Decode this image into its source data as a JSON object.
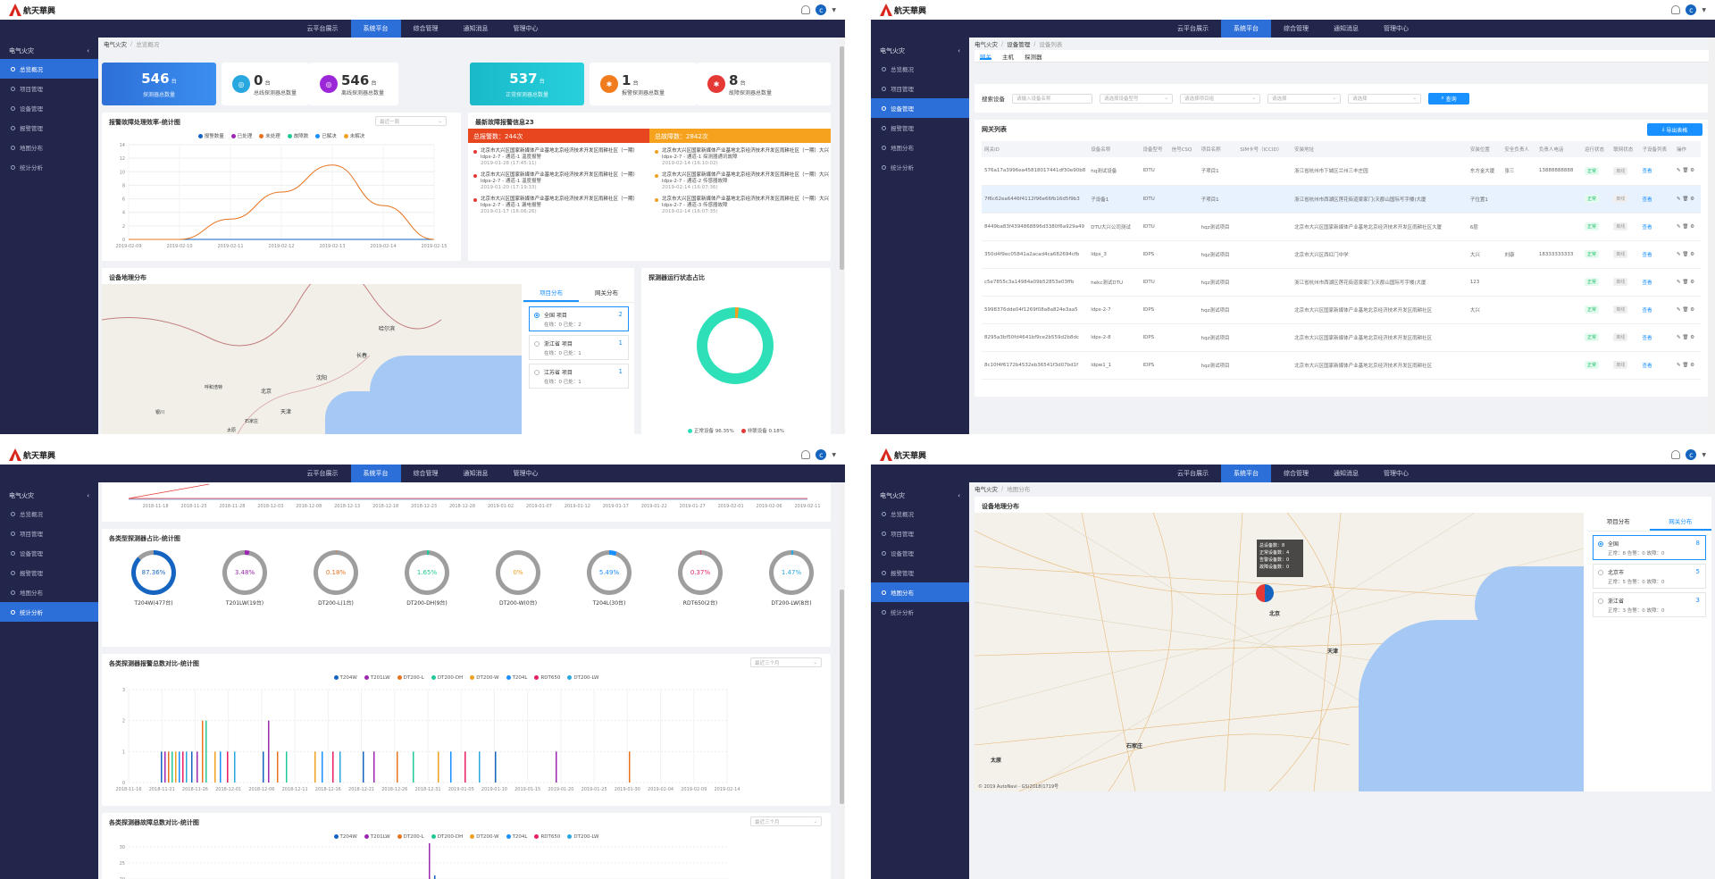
{
  "app": {
    "logo_text": "航天華興",
    "avatar_letter": "c",
    "nav": [
      "云平台展示",
      "系统平台",
      "综合管理",
      "通知消息",
      "管理中心"
    ],
    "active_nav": "系统平台",
    "sidebar_title": "电气火灾",
    "sidebar": [
      "总览概况",
      "项目管理",
      "设备管理",
      "报警管理",
      "地图分布",
      "统计分析"
    ]
  },
  "q1": {
    "breadcrumb": [
      "电气火灾",
      "总览概况"
    ],
    "stats": [
      {
        "num": "546",
        "unit": "台",
        "label": "探测器总数量",
        "style": "blue"
      },
      {
        "num": "0",
        "unit": "台",
        "label": "总线探测器总数量",
        "style": "white",
        "icon_color": "#29a8e0"
      },
      {
        "num": "546",
        "unit": "台",
        "label": "离线探测器总数量",
        "style": "white",
        "icon_color": "#9c27d8"
      },
      {
        "num": "537",
        "unit": "台",
        "label": "正常探测器总数量",
        "style": "cyan"
      },
      {
        "num": "1",
        "unit": "台",
        "label": "报警探测器总数量",
        "style": "white",
        "icon_color": "#f07c1e"
      },
      {
        "num": "8",
        "unit": "台",
        "label": "故障探测器总数量",
        "style": "white",
        "icon_color": "#e53935"
      }
    ],
    "trend_title": "报警故障处理效率-统计图",
    "trend_select": "最近一周",
    "trend_legend": [
      {
        "name": "报警数量",
        "color": "#1565c0"
      },
      {
        "name": "已处理",
        "color": "#9c27b0"
      },
      {
        "name": "未处理",
        "color": "#e8731e"
      },
      {
        "name": "故障数",
        "color": "#20c997"
      },
      {
        "name": "已解决",
        "color": "#1890ff"
      },
      {
        "name": "未解决",
        "color": "#f0a020"
      }
    ],
    "alerts_title": "最新故障报警信息23",
    "alert_total": "总报警数：244次",
    "fault_total": "总故障数：2842次",
    "alerts": [
      {
        "text": "北京市大兴区国家新媒体产业基地北京经济技术开发区雨耕社区（一期）",
        "sub": "ldps-2-7 - 通道-1 温度报警",
        "time": "2019-01-28 (17:45:11)"
      },
      {
        "text": "北京市大兴区国家新媒体产业基地北京经济技术开发区雨耕社区（一期）",
        "sub": "ldps-2-7 - 通道-1 温度报警",
        "time": "2019-01-20 (17:19:33)"
      },
      {
        "text": "北京市大兴区国家新媒体产业基地北京经济技术开发区雨耕社区（一期）",
        "sub": "ldps-2-7 - 通道-1 漏电报警",
        "time": "2019-01-17 (16:06:26)"
      }
    ],
    "faults": [
      {
        "text": "北京市大兴区国家新媒体产业基地北京经济技术开发区雨耕社区（一期）大兴",
        "sub": "ldps-2-7 - 通道-1 探测器通讯故障",
        "time": "2019-02-14 (16:10:02)"
      },
      {
        "text": "北京市大兴区国家新媒体产业基地北京经济技术开发区雨耕社区（一期）大兴",
        "sub": "ldps-2-7 - 通道-2 传感器故障",
        "time": "2019-02-14 (16:07:36)"
      },
      {
        "text": "北京市大兴区国家新媒体产业基地北京经济技术开发区雨耕社区（一期）大兴",
        "sub": "ldps-2-7 - 通道-3 传感器故障",
        "time": "2019-02-14 (16:07:35)"
      }
    ],
    "geo_title": "设备地理分布",
    "geo_tabs": [
      "项目分布",
      "网关分布"
    ],
    "geo_items": [
      {
        "name": "全国 项目",
        "stat": "在线：0  已处：2",
        "count": "2"
      },
      {
        "name": "浙江省 项目",
        "stat": "在线：0  已处：1",
        "count": "1"
      },
      {
        "name": "江苏省 项目",
        "stat": "在线：0  已处：1",
        "count": "1"
      }
    ],
    "map_labels": [
      "北京",
      "天津",
      "沈阳",
      "呼和浩特",
      "长春",
      "哈尔滨",
      "石家庄",
      "太原",
      "银川"
    ],
    "donut_title": "探测器运行状态占比",
    "donut_legend": [
      "正常设备 96.35%",
      "非联设备 0.18%"
    ]
  },
  "q1chart": {
    "chart_data": {
      "type": "line",
      "x": [
        "2019-02-09",
        "2019-02-10",
        "2019-02-11",
        "2019-02-12",
        "2019-02-13",
        "2019-02-14",
        "2019-02-15"
      ],
      "series": [
        {
          "name": "报警数量",
          "values": [
            0,
            0,
            0,
            0,
            0,
            0,
            0
          ]
        },
        {
          "name": "未处理",
          "values": [
            0,
            0,
            3,
            7,
            11,
            5,
            0
          ]
        }
      ],
      "ylim": [
        0,
        14
      ],
      "yticks": [
        0,
        2,
        4,
        6,
        8,
        10,
        12,
        14
      ]
    }
  },
  "q2": {
    "breadcrumb": [
      "电气火灾",
      "设备管理",
      "设备列表"
    ],
    "tabs": [
      "网关",
      "主机",
      "探测器"
    ],
    "filters": {
      "label": "搜索设备",
      "placeholders": [
        "请输入设备名称",
        "请选择设备型号",
        "请选择项目组",
        "请选择",
        "请选择"
      ],
      "search": "查询"
    },
    "list_title": "网关列表",
    "export_btn": "导出表格",
    "columns": [
      "网关ID",
      "设备名称",
      "设备型号",
      "信号CSQ",
      "项目名称",
      "SIM卡号（ICCID）",
      "安装地址",
      "安装位置",
      "安全负责人",
      "负责人电话",
      "运行状态",
      "联网状态",
      "子设备列表",
      "操作"
    ],
    "rows": [
      [
        "576a17a3996ea45818017441df30e90b8",
        "hq测试设备",
        "IDTU",
        "",
        "子项目1",
        "",
        "浙江省杭州市下城区兰州三丰庄园",
        "东方金大厦",
        "张三",
        "13888888888",
        "正常",
        "离线",
        "查看"
      ],
      [
        "7f6c62ea6446f4112f96e66fb16d5f9b3",
        "子设备1",
        "IDTU",
        "",
        "子项目1",
        "",
        "浙江省杭州市西湖区莲花街道梁家门(天郡山国际写字楼)大厦",
        "子位置1",
        "",
        "",
        "正常",
        "离线",
        "查看"
      ],
      [
        "8449ba83f4394868896d3380f6a929a49",
        "DTU大兴公司测试",
        "IDTU",
        "",
        "hqz测试项目",
        "",
        "北京市大兴区国家新媒体产业基地北京经济技术开发区雨耕社区大厦",
        "6层",
        "",
        "",
        "正常",
        "离线",
        "查看"
      ],
      [
        "350d4f9ec05841a2acad4ca682694cfb",
        "ldps_3",
        "IDPS",
        "",
        "hqz测试项目",
        "",
        "北京市大兴区西红门中学",
        "大兴",
        "刘康",
        "18333333333",
        "正常",
        "离线",
        "查看"
      ],
      [
        "c5e7855c3a14984a09b52853e03ffb",
        "hekc测试DTU",
        "IDTU",
        "",
        "hqz测试项目",
        "",
        "浙江省杭州市西湖区莲花街道梁家门(天郡山国际写字楼)大厦",
        "123",
        "",
        "",
        "正常",
        "离线",
        "查看"
      ],
      [
        "5998376dde04f1269f08a8a824e3aa5",
        "ldps-2-7",
        "IDPS",
        "",
        "hqz测试项目",
        "",
        "北京市大兴区国家新媒体产业基地北京经济技术开发区雨耕社区",
        "大兴",
        "",
        "",
        "正常",
        "离线",
        "查看"
      ],
      [
        "8295a3bf50fd4641bf9ce2b559d2b8dc",
        "ldps-2-8",
        "IDPS",
        "",
        "hqz测试项目",
        "",
        "北京市大兴区国家新媒体产业基地北京经济技术开发区雨耕社区",
        "",
        "",
        "",
        "正常",
        "离线",
        "查看"
      ],
      [
        "8c10f4f6172b4532eb36541f3d07bd1f",
        "ldpw1_1",
        "IDPS",
        "",
        "hqz测试项目",
        "",
        "北京市大兴区国家新媒体产业基地北京经济技术开发区雨耕社区",
        "",
        "",
        "",
        "正常",
        "离线",
        "查看"
      ]
    ]
  },
  "q3": {
    "top_x": [
      "2018-11-18",
      "2018-11-23",
      "2018-11-28",
      "2018-12-03",
      "2018-12-08",
      "2018-12-13",
      "2018-12-18",
      "2018-12-23",
      "2018-12-28",
      "2019-01-02",
      "2019-01-07",
      "2019-01-12",
      "2019-01-17",
      "2019-01-22",
      "2019-01-27",
      "2019-02-01",
      "2019-02-06",
      "2019-02-11"
    ],
    "gauges_title": "各类型探测器占比-统计图",
    "gauges": [
      {
        "pct": "87.36%",
        "label": "T204W(477台)",
        "color": "#1565c0",
        "value": 87.36
      },
      {
        "pct": "3.48%",
        "label": "T201LW(19台)",
        "color": "#9c27b0",
        "value": 3.48
      },
      {
        "pct": "0.18%",
        "label": "DT200-L(1台)",
        "color": "#e8731e",
        "value": 0.18
      },
      {
        "pct": "1.65%",
        "label": "DT200-DH(9台)",
        "color": "#20c997",
        "value": 1.65
      },
      {
        "pct": "0%",
        "label": "DT200-W(0台)",
        "color": "#f0a020",
        "value": 0
      },
      {
        "pct": "5.49%",
        "label": "T204L(30台)",
        "color": "#1890ff",
        "value": 5.49
      },
      {
        "pct": "0.37%",
        "label": "RDT650(2台)",
        "color": "#e91e63",
        "value": 0.37
      },
      {
        "pct": "1.47%",
        "label": "DT200-LW(8台)",
        "color": "#29a8e0",
        "value": 1.47
      }
    ],
    "alarm_title": "各类探测器报警总数对比-统计图",
    "fault_title": "各类探测器故障总数对比-统计图",
    "range_select": "最近三个月",
    "legend": [
      {
        "name": "T204W",
        "color": "#1565c0"
      },
      {
        "name": "T201LW",
        "color": "#9c27b0"
      },
      {
        "name": "DT200-L",
        "color": "#e8731e"
      },
      {
        "name": "DT200-DH",
        "color": "#20c997"
      },
      {
        "name": "DT200-W",
        "color": "#f0a020"
      },
      {
        "name": "T204L",
        "color": "#1890ff"
      },
      {
        "name": "RDT650",
        "color": "#e91e63"
      },
      {
        "name": "DT200-LW",
        "color": "#29a8e0"
      }
    ],
    "bar_x": [
      "2018-11-16",
      "2018-11-21",
      "2018-11-26",
      "2018-12-01",
      "2018-12-06",
      "2018-12-11",
      "2018-12-16",
      "2018-12-21",
      "2018-12-26",
      "2018-12-31",
      "2019-01-05",
      "2019-01-10",
      "2019-01-15",
      "2019-01-20",
      "2019-01-25",
      "2019-01-30",
      "2019-02-04",
      "2019-02-09",
      "2019-02-14"
    ],
    "bar_yticks": [
      "3",
      "2",
      "1",
      "0"
    ],
    "fault_yticks": [
      "30",
      "25",
      "20"
    ]
  },
  "q4": {
    "breadcrumb": [
      "电气火灾",
      "地图分布"
    ],
    "geo_title": "设备地理分布",
    "tabs": [
      "项目分布",
      "网关分布"
    ],
    "items": [
      {
        "name": "全国",
        "stat": "正常：8  告警：0  故障：0",
        "count": "8"
      },
      {
        "name": "北京市",
        "stat": "正常：5  告警：0  故障：0",
        "count": "5"
      },
      {
        "name": "浙江省",
        "stat": "正常：3  告警：0  故障：0",
        "count": "3"
      }
    ],
    "tooltip": [
      "总设备数：8",
      "正常设备数：4",
      "告警设备数：0",
      "故障设备数：0"
    ],
    "map_labels": [
      "天津",
      "石家庄",
      "太原",
      "北京"
    ],
    "copyright": "© 2019 AutoNavi - GS(2018)1719号"
  }
}
